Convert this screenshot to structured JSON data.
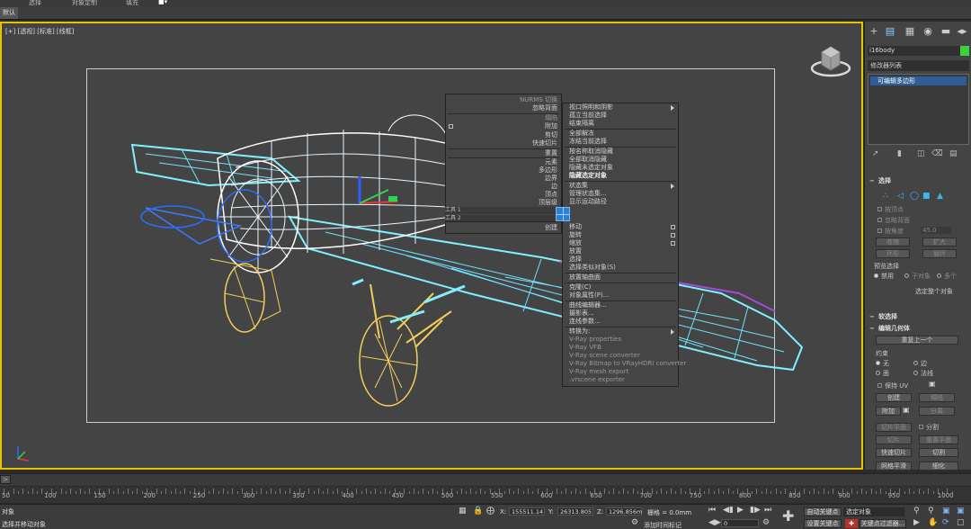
{
  "menubar": {
    "items": [
      "选择",
      "对象定制",
      "填充"
    ]
  },
  "tab": {
    "label": "默认"
  },
  "viewport": {
    "label": "[+] [透视] [标准] [线框]"
  },
  "quad_left": [
    {
      "label": "NURMS 切换",
      "dim": true
    },
    {
      "label": "忽略背面",
      "dim": false
    },
    {
      "label": "塌陷",
      "dim": true
    },
    {
      "label": "附加",
      "dim": false
    },
    {
      "label": "剪切",
      "dim": false
    },
    {
      "label": "快速切片",
      "dim": false
    },
    {
      "label": "重置",
      "dim": false
    },
    {
      "label": "元素",
      "dim": false
    },
    {
      "label": "多边形",
      "dim": false
    },
    {
      "label": "边界",
      "dim": false
    },
    {
      "label": "边",
      "dim": false
    },
    {
      "label": "顶点",
      "dim": false
    },
    {
      "label": "顶层级",
      "dim": false
    }
  ],
  "quad_left2": {
    "label": "创建"
  },
  "quad_tools": {
    "tool1": "工具 1",
    "tool2": "工具 2",
    "disp1": "显示",
    "disp2": "变换"
  },
  "quad_right_top": [
    {
      "label": "视口照明和阴影",
      "arrow": true,
      "bold": false
    },
    {
      "label": "孤立当前选择",
      "arrow": false,
      "bold": false
    },
    {
      "label": "结束隔离",
      "arrow": false,
      "bold": false
    },
    {
      "label": "全部解冻",
      "arrow": false,
      "bold": false
    },
    {
      "label": "冻结当前选择",
      "arrow": false,
      "bold": false
    },
    {
      "label": "按名称取消隐藏",
      "arrow": false,
      "bold": false
    },
    {
      "label": "全部取消隐藏",
      "arrow": false,
      "bold": false
    },
    {
      "label": "隐藏未选定对象",
      "arrow": false,
      "bold": false
    },
    {
      "label": "隐藏选定对象",
      "arrow": false,
      "bold": true
    },
    {
      "label": "状态集",
      "arrow": true,
      "bold": false
    },
    {
      "label": "管理状态集...",
      "arrow": false,
      "bold": false
    },
    {
      "label": "显示运动路径",
      "arrow": false,
      "bold": false
    }
  ],
  "quad_right_bottom": [
    {
      "label": "移动",
      "check": true
    },
    {
      "label": "旋转",
      "check": true
    },
    {
      "label": "缩放",
      "check": true
    },
    {
      "label": "放置",
      "check": false
    },
    {
      "label": "选择",
      "check": false
    },
    {
      "label": "选择类似对象(S)",
      "check": false
    },
    {
      "label": "放置轴曲面",
      "check": false
    },
    {
      "label": "克隆(C)",
      "check": false
    },
    {
      "label": "对象属性(P)...",
      "check": false
    },
    {
      "label": "曲线编辑器...",
      "check": false
    },
    {
      "label": "摄影表...",
      "check": false
    },
    {
      "label": "连线参数...",
      "check": false
    },
    {
      "label": "转换为:",
      "check": false
    },
    {
      "label": "V-Ray properties",
      "check": false
    },
    {
      "label": "V-Ray VFB",
      "check": false
    },
    {
      "label": "V-Ray scene converter",
      "check": false
    },
    {
      "label": "V-Ray Bitmap to VRayHDRI converter",
      "check": false
    },
    {
      "label": "V-Ray mesh export",
      "check": false
    },
    {
      "label": ".vrscene exporter",
      "check": false
    }
  ],
  "cmdpanel": {
    "object_name": "i16body",
    "object_color": "#3cd23c",
    "modifier_list": "修改器列表",
    "stack_item": "可编辑多边形",
    "selection": {
      "title": "选择",
      "by_vertex": "按顶点",
      "ignore_back": "忽略背面",
      "by_angle": "按角度",
      "angle_value": "45.0",
      "shrink": "收缩",
      "grow": "扩大",
      "ring": "环形",
      "loop": "循环",
      "preview": "预览选择",
      "disabled": "禁用",
      "subobject": "子对象",
      "multi": "多个",
      "select_whole": "选定整个对象"
    },
    "soft_sel": "软选择",
    "edit_geo": {
      "title": "编辑几何体",
      "repeat_last": "重复上一个",
      "constraints": "约束",
      "none": "无",
      "edge": "边",
      "face": "面",
      "normal": "法线",
      "preserve_uv": "保持 UV",
      "create": "创建",
      "collapse": "塌陷",
      "attach": "附加",
      "detach": "分离",
      "slice_plane": "切片平面",
      "split": "分割",
      "slice": "切片",
      "reset_plane": "重置平面",
      "quickslice": "快速切片",
      "cut": "切割",
      "mesh_smooth": "网格平滑",
      "tessellate": "细化"
    }
  },
  "timeline": {
    "slider": ">",
    "ticks": [
      "50",
      "100",
      "150",
      "200",
      "250",
      "300",
      "350",
      "400",
      "450",
      "500",
      "550",
      "600",
      "650",
      "700",
      "750",
      "800",
      "850",
      "900",
      "950",
      "1000"
    ]
  },
  "status": {
    "selected": "对象",
    "prompt": "选择并移动对象",
    "x_label": "X:",
    "x_value": "155511.14",
    "y_label": "Y:",
    "y_value": "26313.805",
    "z_label": "Z:",
    "z_value": "1296.856m",
    "grid_label": "栅格 = 0.0mm",
    "add_time_tag": "添加时间标记",
    "auto_key": "自动关键点",
    "selected_obj": "选定对象",
    "set_key": "设置关键点",
    "key_filters": "关键点过滤器...",
    "frame": "0"
  }
}
